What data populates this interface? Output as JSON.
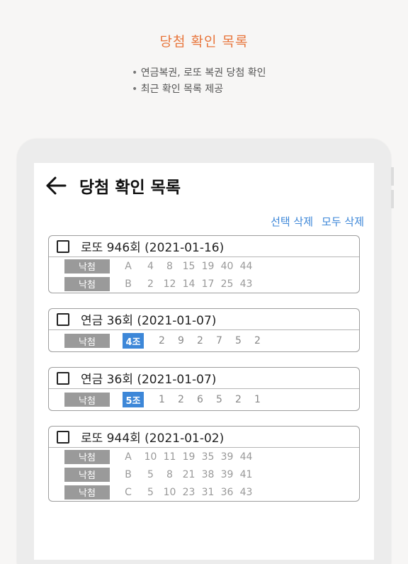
{
  "promo": {
    "title": "당첨 확인 목록",
    "bullets": [
      "연금복권, 로또 복권 당첨 확인",
      "최근 확인 목록 제공"
    ]
  },
  "nav": {
    "back_icon": "arrow-left-icon",
    "title": "당첨 확인 목록"
  },
  "actions": {
    "delete_selected": "선택 삭제",
    "delete_all": "모두 삭제"
  },
  "colors": {
    "accent": "#3d87d8",
    "promo": "#e8763c",
    "badge": "#9a9a9a"
  },
  "cards": [
    {
      "type": "lotto",
      "title": "로또 946회 (2021-01-16)",
      "rows": [
        {
          "result": "낙첨",
          "set": "A",
          "numbers": [
            "4",
            "8",
            "15",
            "19",
            "40",
            "44"
          ]
        },
        {
          "result": "낙첨",
          "set": "B",
          "numbers": [
            "2",
            "12",
            "14",
            "17",
            "25",
            "43"
          ]
        }
      ]
    },
    {
      "type": "pension",
      "title": "연금 36회 (2021-01-07)",
      "rows": [
        {
          "result": "낙첨",
          "group": "4조",
          "numbers": [
            "2",
            "9",
            "2",
            "7",
            "5",
            "2"
          ]
        }
      ]
    },
    {
      "type": "pension",
      "title": "연금 36회 (2021-01-07)",
      "rows": [
        {
          "result": "낙첨",
          "group": "5조",
          "numbers": [
            "1",
            "2",
            "6",
            "5",
            "2",
            "1"
          ]
        }
      ]
    },
    {
      "type": "lotto",
      "title": "로또 944회 (2021-01-02)",
      "rows": [
        {
          "result": "낙첨",
          "set": "A",
          "numbers": [
            "10",
            "11",
            "19",
            "35",
            "39",
            "44"
          ]
        },
        {
          "result": "낙첨",
          "set": "B",
          "numbers": [
            "5",
            "8",
            "21",
            "38",
            "39",
            "41"
          ]
        },
        {
          "result": "낙첨",
          "set": "C",
          "numbers": [
            "5",
            "10",
            "23",
            "31",
            "36",
            "43"
          ]
        }
      ]
    }
  ]
}
